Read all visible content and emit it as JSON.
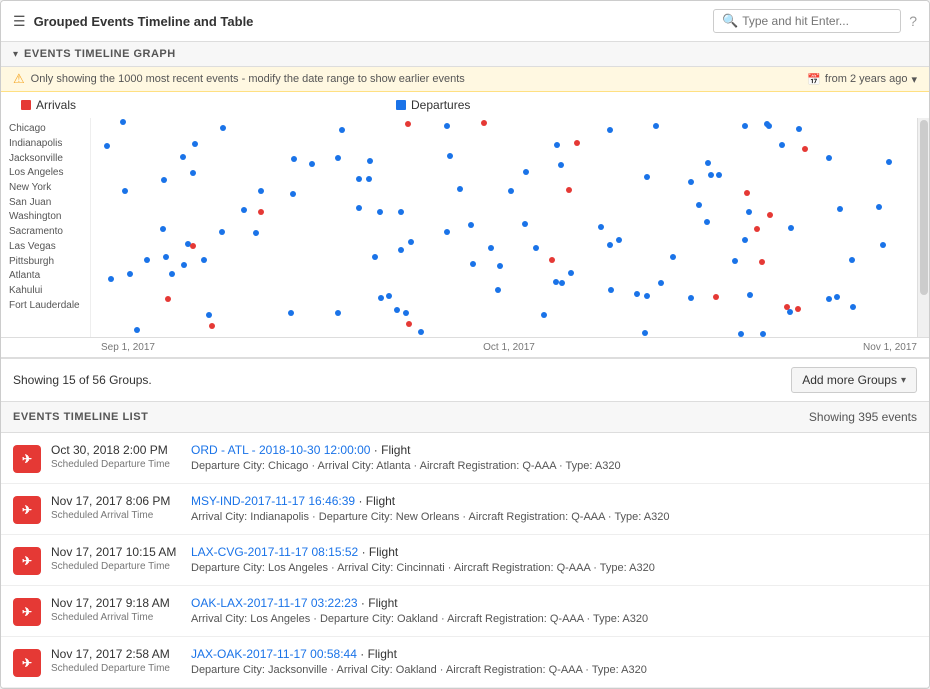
{
  "header": {
    "icon": "≡",
    "title": "Grouped Events Timeline and Table",
    "search_placeholder": "Type and hit Enter...",
    "help_icon": "?"
  },
  "timeline": {
    "collapse_arrow": "▾",
    "section_title": "EVENTS TIMELINE GRAPH",
    "warning_text": "Only showing the 1000 most recent events - modify the date range to show earlier events",
    "date_range_label": "from 2 years ago",
    "calendar_icon": "📅"
  },
  "legend": {
    "arrivals_label": "Arrivals",
    "departures_label": "Departures"
  },
  "y_axis": {
    "labels": [
      "Chicago",
      "Indianapolis",
      "Jacksonville",
      "Los Angeles",
      "New York",
      "San Juan",
      "Washington",
      "Sacramento",
      "Las Vegas",
      "Pittsburgh",
      "Atlanta",
      "Kahului",
      "Fort Lauderdale"
    ]
  },
  "x_axis": {
    "labels": [
      "Sep 1, 2017",
      "Oct 1, 2017",
      "Nov 1, 2017"
    ]
  },
  "groups": {
    "info_text": "Showing 15 of 56 Groups.",
    "add_button_label": "Add more Groups"
  },
  "events_list": {
    "title": "EVENTS TIMELINE LIST",
    "count_label": "Showing 395 events",
    "rows": [
      {
        "time": "Oct 30, 2018 2:00 PM",
        "time_label": "Scheduled Departure Time",
        "link": "ORD - ATL - 2018-10-30 12:00:00",
        "type": "Flight",
        "meta": "Departure City: Chicago  ·  Arrival City: Atlanta  ·  Aircraft Registration: Q-AAA  ·  Type: A320"
      },
      {
        "time": "Nov 17, 2017 8:06 PM",
        "time_label": "Scheduled Arrival Time",
        "link": "MSY-IND-2017-11-17 16:46:39",
        "type": "Flight",
        "meta": "Arrival City: Indianapolis  ·  Departure City: New Orleans  ·  Aircraft Registration: Q-AAA  ·  Type: A320"
      },
      {
        "time": "Nov 17, 2017 10:15 AM",
        "time_label": "Scheduled Departure Time",
        "link": "LAX-CVG-2017-11-17 08:15:52",
        "type": "Flight",
        "meta": "Departure City: Los Angeles  ·  Arrival City: Cincinnati  ·  Aircraft Registration: Q-AAA  ·  Type: A320"
      },
      {
        "time": "Nov 17, 2017 9:18 AM",
        "time_label": "Scheduled Arrival Time",
        "link": "OAK-LAX-2017-11-17 03:22:23",
        "type": "Flight",
        "meta": "Arrival City: Los Angeles  ·  Departure City: Oakland  ·  Aircraft Registration: Q-AAA  ·  Type: A320"
      },
      {
        "time": "Nov 17, 2017 2:58 AM",
        "time_label": "Scheduled Departure Time",
        "link": "JAX-OAK-2017-11-17 00:58:44",
        "type": "Flight",
        "meta": "Departure City: Jacksonville  ·  Arrival City: Oakland  ·  Aircraft Registration: Q-AAA  ·  Type: A320"
      }
    ]
  },
  "colors": {
    "blue": "#1a73e8",
    "red": "#e53935",
    "warning_bg": "#fff8e1",
    "warning_border": "#ffe082"
  }
}
